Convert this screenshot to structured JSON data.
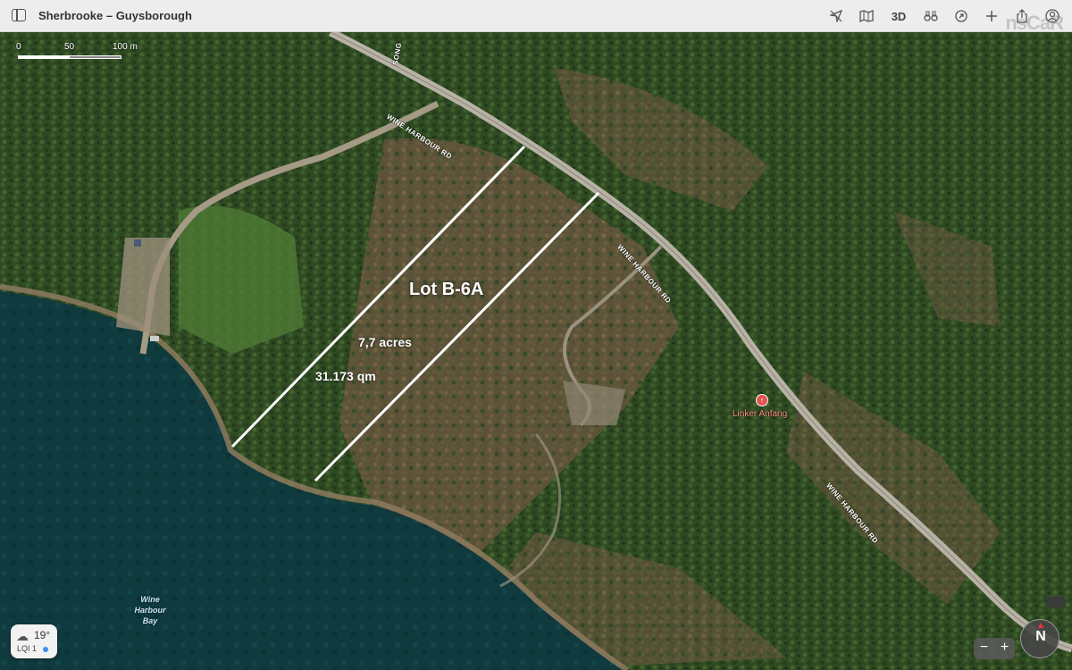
{
  "window": {
    "title": "Sherbrooke – Guysborough"
  },
  "toolbar": {
    "three_d_label": "3D",
    "watermark": "nsCaR"
  },
  "scale": {
    "labels": [
      "0",
      "50",
      "100 m"
    ]
  },
  "lot": {
    "name": "Lot B-6A",
    "acres": "7,7 acres",
    "area": "31.173 qm"
  },
  "roads": {
    "wine_harbour_1": "WINE HARBOUR RD",
    "wine_harbour_2": "WINE HARBOUR RD",
    "wine_harbour_3": "WINE HARBOUR RD",
    "song": "SONG"
  },
  "pin": {
    "label": "Linker Anfang"
  },
  "bay": {
    "label": "Wine Harbour Bay"
  },
  "weather": {
    "temp": "19°",
    "lqi": "LQI 1"
  },
  "zoom": {
    "minus": "−",
    "plus": "+"
  },
  "compass": {
    "label": "N"
  }
}
